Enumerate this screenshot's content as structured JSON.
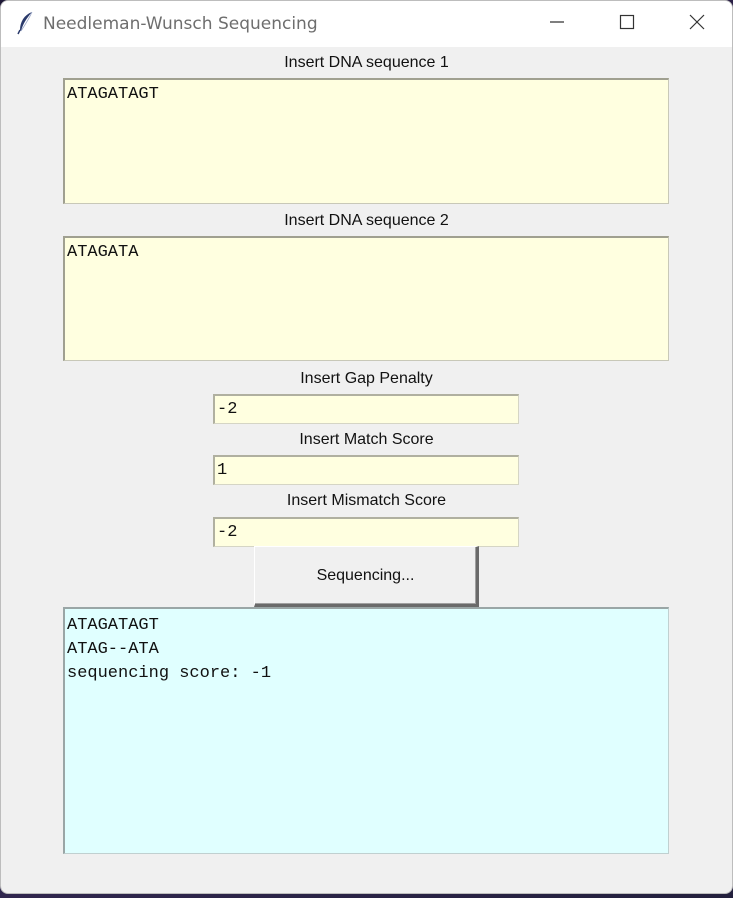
{
  "window": {
    "title": "Needleman-Wunsch Sequencing",
    "icon": "feather-icon",
    "controls": [
      "minimize-icon",
      "maximize-icon",
      "close-icon"
    ]
  },
  "form": {
    "seq1_label": "Insert DNA sequence 1",
    "seq1_value": "ATAGATAGT",
    "seq2_label": "Insert DNA sequence 2",
    "seq2_value": "ATAGATA",
    "gap_label": "Insert Gap Penalty",
    "gap_value": "-2",
    "match_label": "Insert Match Score",
    "match_value": "1",
    "mismatch_label": "Insert Mismatch Score",
    "mismatch_value": "-2",
    "run_button": "Sequencing..."
  },
  "output": {
    "lines": [
      "ATAGATAGT",
      "ATAG--ATA",
      "sequencing score: -1"
    ]
  },
  "colors": {
    "input_background": "#ffffe0",
    "output_background": "#e0ffff",
    "window_background": "#f0f0f0"
  }
}
